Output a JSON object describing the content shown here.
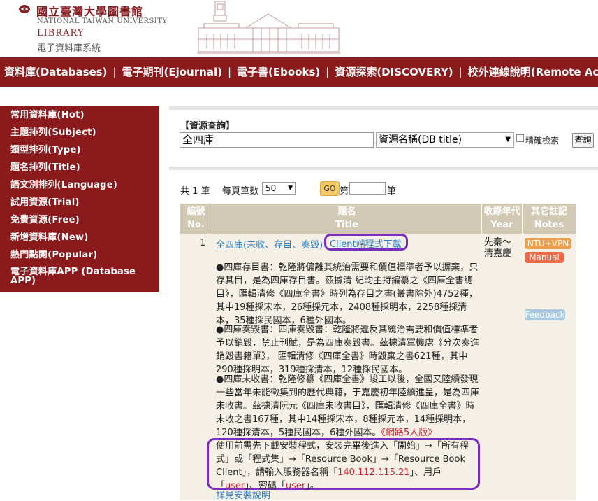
{
  "header": {
    "library_name_zh": "國立臺灣大學圖書館",
    "library_name_en": "NATIONAL TAIWAN UNIVERSITY",
    "library_label": "LIBRARY",
    "system_name": "電子資料庫系統"
  },
  "top_nav": {
    "items": [
      "資料庫(Databases)",
      "電子期刊(Ejournal)",
      "電子書(Ebooks)",
      "資源探索(DISCOVERY)",
      "校外連線說明(Remote Access)"
    ],
    "separator": "|"
  },
  "sidebar": {
    "items": [
      "常用資料庫(Hot)",
      "主題排列(Subject)",
      "類型排列(Type)",
      "題名排列(Title)",
      "語文別排列(Language)",
      "試用資源(Trial)",
      "免費資源(Free)",
      "新增資料庫(New)",
      "熱門點閱(Popular)",
      "電子資料庫APP (Database",
      "APP)"
    ]
  },
  "search": {
    "title": "【資源查詢】",
    "query": "全四庫",
    "field_selected": "資源名稱(DB title)",
    "exact_label": "精確檢索",
    "submit_label": "查詢"
  },
  "results": {
    "count_text": "共 1 筆",
    "per_page_label": "每頁筆數",
    "per_page_value": "50",
    "go_label": "GO",
    "page_prefix": "第",
    "page_suffix": "筆",
    "columns": {
      "no_zh": "編號",
      "no_en": "No.",
      "title_zh": "題名",
      "title_en": "Title",
      "year_zh": "收錄年代",
      "year_en": "Year",
      "notes_zh": "其它註記",
      "notes_en": "Notes"
    },
    "row": {
      "no": "1",
      "title": "全四庫(未收、存目、奏毀)",
      "client_download": "Client端程式下載",
      "year_line1": "先秦～",
      "year_line2": "清嘉慶",
      "badge_vpn": "NTU+VPN",
      "badge_manual": "Manual",
      "badge_feedback": "Feedback",
      "desc1": "●四庫存目書：乾隆將偏離其統治需要和價值標準者予以摒棄，只存其目，是為四庫存目書。茲據清 紀昀主持編纂之《四庫全書總目》，匯輯清修《四庫全書》時列為存目之書(叢書除外)4752種，其中19種採宋本，26種採元本，2408種採明本，2258種採清本，35種採民國本，6種外國本。",
      "desc2": "●四庫奏毀書：四庫奏毀書：乾隆將違反其統治需要和價值標準者予以銷毀，禁止刊賦，是為四庫奏毀書。茲據清軍機處《分次奏進銷毀書籍單》， 匯輯清修《四庫全書》時毀棄之書621種，其中290種採明本，319種採清本，12種採民國本。",
      "desc3": "●四庫未收書：乾隆修纂《四庫全書》峻工以後，全國又陸續發現一些當年未能徵集到的歷代典籍，于嘉慶初年陸續進呈，是為四庫未收書。茲據清阮元《四庫未收書目》，匯輯清修《四庫全書》時未收之書167種，其中14種採宋本，8種採元本，14種採明本，120種採清本，5種民國本，6種外國本。",
      "user_limit": "《網路5人版》",
      "install_note_part1": "使用前需先下載安裝程式，安裝完畢後進入「開始」→「所有程式」或「程式集」→「Resource Book」→「Resource Book Client」，請輸入服務器名稱「",
      "server_name": "140.112.115.21",
      "install_note_part2": "」、用戶「",
      "username": "user",
      "install_note_part3": "」、密碼「",
      "password": "user",
      "install_note_part4": "」。",
      "install_more": "詳見安裝說明"
    }
  },
  "colors": {
    "brand_red": "#8b1a1c",
    "table_header": "#d2c9b4",
    "row_bg": "#f4f0e6",
    "link_blue": "#2a7fc4",
    "highlight_purple": "#7a2fbf"
  }
}
